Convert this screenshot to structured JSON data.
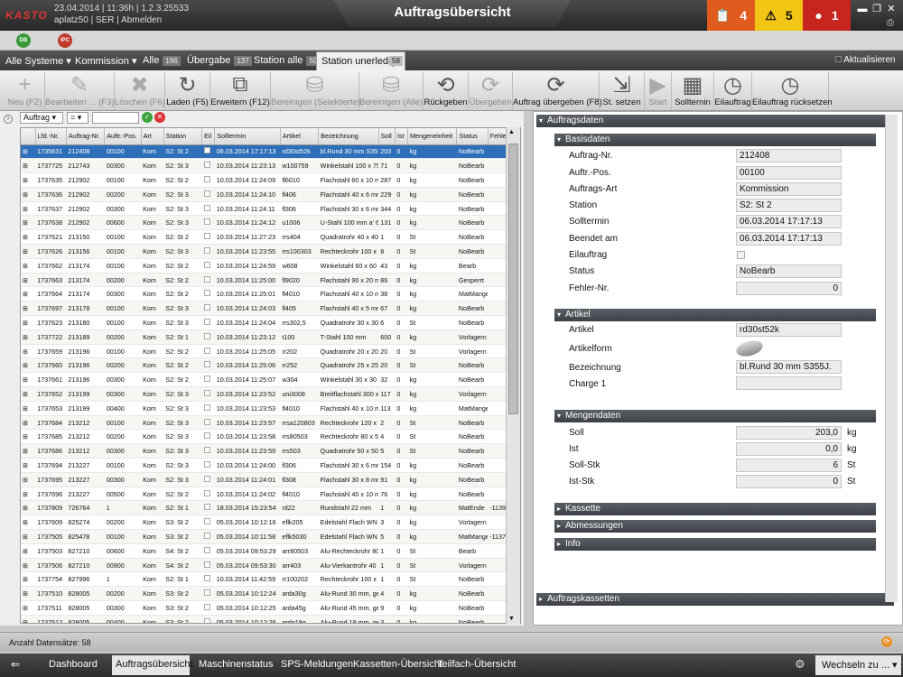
{
  "header": {
    "logo": "KASTO",
    "datetime": "23.04.2014 | 11:36h | 1.2.3.25533",
    "user": "aplatz50 | SER | Abmelden",
    "title": "Auftragsübersicht",
    "alerts": [
      {
        "icon": "clipboard-icon",
        "count": "4",
        "color": "#e25b1e"
      },
      {
        "icon": "warning-icon",
        "count": "5",
        "color": "#f1c514"
      },
      {
        "icon": "siren-icon",
        "count": "1",
        "color": "#c8251f"
      }
    ]
  },
  "subbar": {
    "badges": [
      "DB",
      "IPC"
    ]
  },
  "nav": {
    "system": "Alle Systeme",
    "mode": "Kommission",
    "tabs": [
      {
        "label": "Alle",
        "count": "196"
      },
      {
        "label": "Übergabe",
        "count": "137"
      },
      {
        "label": "Station alle",
        "count": "59"
      },
      {
        "label": "Station unerledigt",
        "count": "58"
      }
    ],
    "refresh_label": "Aktualisieren"
  },
  "toolbar": [
    {
      "label": "Neu (F2)",
      "icon": "+",
      "enabled": false
    },
    {
      "label": "Bearbeiten ... (F3)",
      "icon": "✎",
      "enabled": false
    },
    {
      "label": "Löschen (F6)",
      "icon": "✖",
      "enabled": false
    },
    {
      "label": "Laden (F5)",
      "icon": "↻",
      "enabled": true
    },
    {
      "label": "Erweitern (F12)",
      "icon": "⧉",
      "enabled": true
    },
    {
      "label": "Bereinigen (Selektierte)",
      "icon": "⛁",
      "enabled": false
    },
    {
      "label": "Bereinigen (Alle)",
      "icon": "⛁",
      "enabled": false
    },
    {
      "label": "Rückgeben",
      "icon": "⟲",
      "enabled": true
    },
    {
      "label": "Übergeben",
      "icon": "⟳",
      "enabled": false
    },
    {
      "label": "Auftrag übergeben (F8)",
      "icon": "⟳",
      "enabled": true
    },
    {
      "label": "St. setzen",
      "icon": "⇲",
      "enabled": true
    },
    {
      "label": "Start",
      "icon": "▶",
      "enabled": false
    },
    {
      "label": "Sollternin",
      "icon": "▦",
      "enabled": true
    },
    {
      "label": "Eilauftrag",
      "icon": "◷",
      "enabled": true
    },
    {
      "label": "Eilauftrag rücksetzen",
      "icon": "◷",
      "enabled": true
    }
  ],
  "filter": {
    "field": "Auftrag",
    "op": "=",
    "value": ""
  },
  "table": {
    "columns": [
      "Lfd.-Nr.",
      "Auftrag-Nr.",
      "Auftr.-Pos.",
      "Art",
      "Station",
      "Eil",
      "Solltermin",
      "Artikel",
      "Bezeichnung",
      "Soll",
      "Ist",
      "Mengeneinheit",
      "Status",
      "Fehle"
    ],
    "rows": [
      [
        "1735631",
        "212408",
        "00100",
        "Kom",
        "S2: St 2",
        "06.03.2014 17:17:13",
        "rd30st52k",
        "bl.Rund 30 mm S355",
        "203",
        "0",
        "kg",
        "NoBearb",
        ""
      ],
      [
        "1737725",
        "212743",
        "00300",
        "Kom",
        "S2: St 3",
        "10.03.2014 11:23:13",
        "w100759",
        "Winkelstahl 100 x 75",
        "71",
        "0",
        "kg",
        "NoBearb",
        ""
      ],
      [
        "1737635",
        "212902",
        "00100",
        "Kom",
        "S2: St 2",
        "10.03.2014 11:24:09",
        "fl6010",
        "Flachstahl 60 x 10 m",
        "287",
        "0",
        "kg",
        "NoBearb",
        ""
      ],
      [
        "1737636",
        "212902",
        "00200",
        "Kom",
        "S2: St 3",
        "10.03.2014 11:24:10",
        "fl406",
        "Flachstahl 40 x 6 mr",
        "229",
        "0",
        "kg",
        "NoBearb",
        ""
      ],
      [
        "1737637",
        "212902",
        "00300",
        "Kom",
        "S2: St 3",
        "10.03.2014 11:24:11",
        "fl306",
        "Flachstahl 30 x 6 mr",
        "344",
        "0",
        "kg",
        "NoBearb",
        ""
      ],
      [
        "1737638",
        "212902",
        "00600",
        "Kom",
        "S2: St 3",
        "10.03.2014 11:24:12",
        "u1006",
        "U-Stahl 100 mm a' 6",
        "131",
        "0",
        "kg",
        "NoBearb",
        ""
      ],
      [
        "1737621",
        "213150",
        "00100",
        "Kom",
        "S2: St 2",
        "10.03.2014 11:27:23",
        "rrs404",
        "Quadratrohr 40 x 40",
        "1",
        "0",
        "St",
        "NoBearb",
        ""
      ],
      [
        "1737626",
        "213156",
        "00100",
        "Kom",
        "S2: St 3",
        "10.03.2014 11:23:55",
        "rrs100303",
        "Rechteckrohr 100 x",
        "8",
        "0",
        "St",
        "NoBearb",
        ""
      ],
      [
        "1737662",
        "213174",
        "00100",
        "Kom",
        "S2: St 2",
        "10.03.2014 11:24:59",
        "w608",
        "Winkelstahl 60 x 60",
        "43",
        "0",
        "kg",
        "Bearb",
        ""
      ],
      [
        "1737663",
        "213174",
        "00200",
        "Kom",
        "S2: St 2",
        "10.03.2014 11:25:00",
        "fl9020",
        "Flachstahl 90 x 20 m",
        "86",
        "0",
        "kg",
        "Gesperrt",
        ""
      ],
      [
        "1737664",
        "213174",
        "00300",
        "Kom",
        "S2: St 2",
        "10.03.2014 11:25:01",
        "fl4010",
        "Flachstahl 40 x 10 m",
        "38",
        "0",
        "kg",
        "MatMange",
        ""
      ],
      [
        "1737697",
        "213178",
        "00100",
        "Kom",
        "S2: St 3",
        "10.03.2014 11:24:03",
        "fl405",
        "Flachstahl 40 x 5 mr",
        "67",
        "0",
        "kg",
        "NoBearb",
        ""
      ],
      [
        "1737623",
        "213180",
        "00100",
        "Kom",
        "S2: St 3",
        "10.03.2014 11:24:04",
        "rrs302,5",
        "Quadratrohr 30 x 30",
        "6",
        "0",
        "St",
        "NoBearb",
        ""
      ],
      [
        "1737722",
        "213189",
        "00200",
        "Kom",
        "S2: St 1",
        "10.03.2014 11:23:12",
        "t100",
        "T-Stahl 100 mm",
        "600",
        "0",
        "kg",
        "Vorlagern",
        ""
      ],
      [
        "1737659",
        "213196",
        "00100",
        "Kom",
        "S2: St 2",
        "10.03.2014 11:25:05",
        "rr202",
        "Quadratrohr 20 x 20",
        "20",
        "0",
        "St",
        "Vorlagern",
        ""
      ],
      [
        "1737660",
        "213196",
        "00200",
        "Kom",
        "S2: St 2",
        "10.03.2014 11:25:06",
        "rr252",
        "Quadratrohr 25 x 25",
        "20",
        "0",
        "St",
        "NoBearb",
        ""
      ],
      [
        "1737661",
        "213196",
        "00300",
        "Kom",
        "S2: St 2",
        "10.03.2014 11:25:07",
        "w304",
        "Winkelstahl 30 x 30",
        "32",
        "0",
        "kg",
        "NoBearb",
        ""
      ],
      [
        "1737652",
        "213199",
        "00300",
        "Kom",
        "S2: St 3",
        "10.03.2014 11:23:52",
        "uni3008",
        "Breitflachstahl 300 x",
        "117",
        "0",
        "kg",
        "Vorlagern",
        ""
      ],
      [
        "1737653",
        "213199",
        "00400",
        "Kom",
        "S2: St 3",
        "10.03.2014 11:23:53",
        "fl4010",
        "Flachstahl 40 x 10 m",
        "113",
        "0",
        "kg",
        "MatMange",
        ""
      ],
      [
        "1737684",
        "213212",
        "00100",
        "Kom",
        "S2: St 3",
        "10.03.2014 11:23:57",
        "rrsa120803",
        "Rechteckrohr 120 x",
        "2",
        "0",
        "St",
        "NoBearb",
        ""
      ],
      [
        "1737685",
        "213212",
        "00200",
        "Kom",
        "S2: St 3",
        "10.03.2014 11:23:58",
        "rrs80503",
        "Rechteckrohr 80 x 5",
        "4",
        "0",
        "St",
        "NoBearb",
        ""
      ],
      [
        "1737686",
        "213212",
        "00300",
        "Kom",
        "S2: St 3",
        "10.03.2014 11:23:59",
        "rrs503",
        "Quadratrohr 50 x 50",
        "5",
        "0",
        "St",
        "NoBearb",
        ""
      ],
      [
        "1737694",
        "213227",
        "00100",
        "Kom",
        "S2: St 3",
        "10.03.2014 11:24:00",
        "fl306",
        "Flachstahl 30 x 6 mr",
        "154",
        "0",
        "kg",
        "NoBearb",
        ""
      ],
      [
        "1737695",
        "213227",
        "00300",
        "Kom",
        "S2: St 3",
        "10.03.2014 11:24:01",
        "fl308",
        "Flachstahl 30 x 8 mr",
        "91",
        "0",
        "kg",
        "NoBearb",
        ""
      ],
      [
        "1737696",
        "213227",
        "00500",
        "Kom",
        "S2: St 2",
        "10.03.2014 11:24:02",
        "fl4010",
        "Flachstahl 40 x 10 m",
        "76",
        "0",
        "kg",
        "NoBearb",
        ""
      ],
      [
        "1737809",
        "726764",
        "1",
        "Kom",
        "S2: St 1",
        "18.03.2014 15:23:54",
        "rd22",
        "Rundstahl 22 mm",
        "1",
        "0",
        "kg",
        "MatEnde",
        "-1139"
      ],
      [
        "1737609",
        "825274",
        "00200",
        "Kom",
        "S3: St 2",
        "05.03.2014 10:12:16",
        "eflk205",
        "Edelstahl Flach WN -",
        "3",
        "0",
        "kg",
        "Vorlagern",
        ""
      ],
      [
        "1737505",
        "825478",
        "00100",
        "Kom",
        "S3: St 2",
        "05.03.2014 10:11:58",
        "eflk5030",
        "Edelstahl Flach WN -",
        "5",
        "0",
        "kg",
        "MatMange",
        "-1137"
      ],
      [
        "1737503",
        "827210",
        "00600",
        "Kom",
        "S4: St 2",
        "05.03.2014 09:53:29",
        "arr80503",
        "Alu-Rechteckrohr 80",
        "1",
        "0",
        "St",
        "Bearb",
        ""
      ],
      [
        "1737506",
        "827210",
        "00900",
        "Kom",
        "S4: St 2",
        "05.03.2014 09:53:30",
        "arr403",
        "Alu-Vierkantrohr 40",
        "1",
        "0",
        "St",
        "Vorlagern",
        ""
      ],
      [
        "1737754",
        "827996",
        "1",
        "Kom",
        "S2: St 1",
        "10.03.2014 11:42:59",
        "rr100202",
        "Rechteckrohr 100 x",
        "1",
        "0",
        "St",
        "NoBearb",
        ""
      ],
      [
        "1737510",
        "828005",
        "00200",
        "Kom",
        "S3: St 2",
        "05.03.2014 10:12:24",
        "arda30g",
        "Alu-Rund 30 mm, gez",
        "4",
        "0",
        "kg",
        "NoBearb",
        ""
      ],
      [
        "1737511",
        "828005",
        "00300",
        "Kom",
        "S3: St 2",
        "05.03.2014 10:12:25",
        "arda45g",
        "Alu-Rund 45 mm, gez",
        "9",
        "0",
        "kg",
        "NoBearb",
        ""
      ],
      [
        "1737512",
        "828005",
        "00400",
        "Kom",
        "S3: St 2",
        "05.03.2014 10:12:26",
        "ardg18g",
        "Alu-Rund 18 mm, gez",
        "3",
        "0",
        "kg",
        "NoBearb",
        ""
      ]
    ]
  },
  "detail": {
    "title": "Auftragsdaten",
    "basis": {
      "title": "Basisdaten",
      "fields": [
        {
          "label": "Auftrag-Nr.",
          "value": "212408"
        },
        {
          "label": "Auftr.-Pos.",
          "value": "00100"
        },
        {
          "label": "Auftrags-Art",
          "value": "Kommission"
        },
        {
          "label": "Station",
          "value": "S2: St  2"
        },
        {
          "label": "Solltermin",
          "value": "06.03.2014 17:17:13"
        },
        {
          "label": "Beendet  am",
          "value": "06.03.2014 17:17:13"
        },
        {
          "label": "Eilauftrag",
          "value": ""
        },
        {
          "label": "Status",
          "value": "NoBearb"
        },
        {
          "label": "Fehler-Nr.",
          "value": "0"
        }
      ]
    },
    "artikel": {
      "title": "Artikel",
      "artikel_label": "Artikel",
      "artikel_value": "rd30st52k",
      "form_label": "Artikelform",
      "bez_label": "Bezeichnung",
      "bez_value": "bl.Rund 30 mm S355J.",
      "charge_label": "Charge 1",
      "charge_value": ""
    },
    "menge": {
      "title": "Mengendaten",
      "rows": [
        {
          "label": "Soll",
          "value": "203,0",
          "unit": "kg"
        },
        {
          "label": "Ist",
          "value": "0,0",
          "unit": "kg"
        },
        {
          "label": "Soll-Stk",
          "value": "6",
          "unit": "St"
        },
        {
          "label": "Ist-Stk",
          "value": "0",
          "unit": "St"
        }
      ]
    },
    "collapsed": [
      "Kassette",
      "Abmessungen",
      "Info"
    ],
    "footer_section": "Auftragskassetten"
  },
  "status": {
    "count_text": "Anzahl Datensätze: 58"
  },
  "bottomnav": {
    "items": [
      "Dashboard",
      "Auftragsübersicht",
      "Maschinenstatus",
      "SPS-Meldungen",
      "Kassetten-Übersicht",
      "Teilfach-Übersicht"
    ],
    "switch_label": "Wechseln zu ..."
  }
}
